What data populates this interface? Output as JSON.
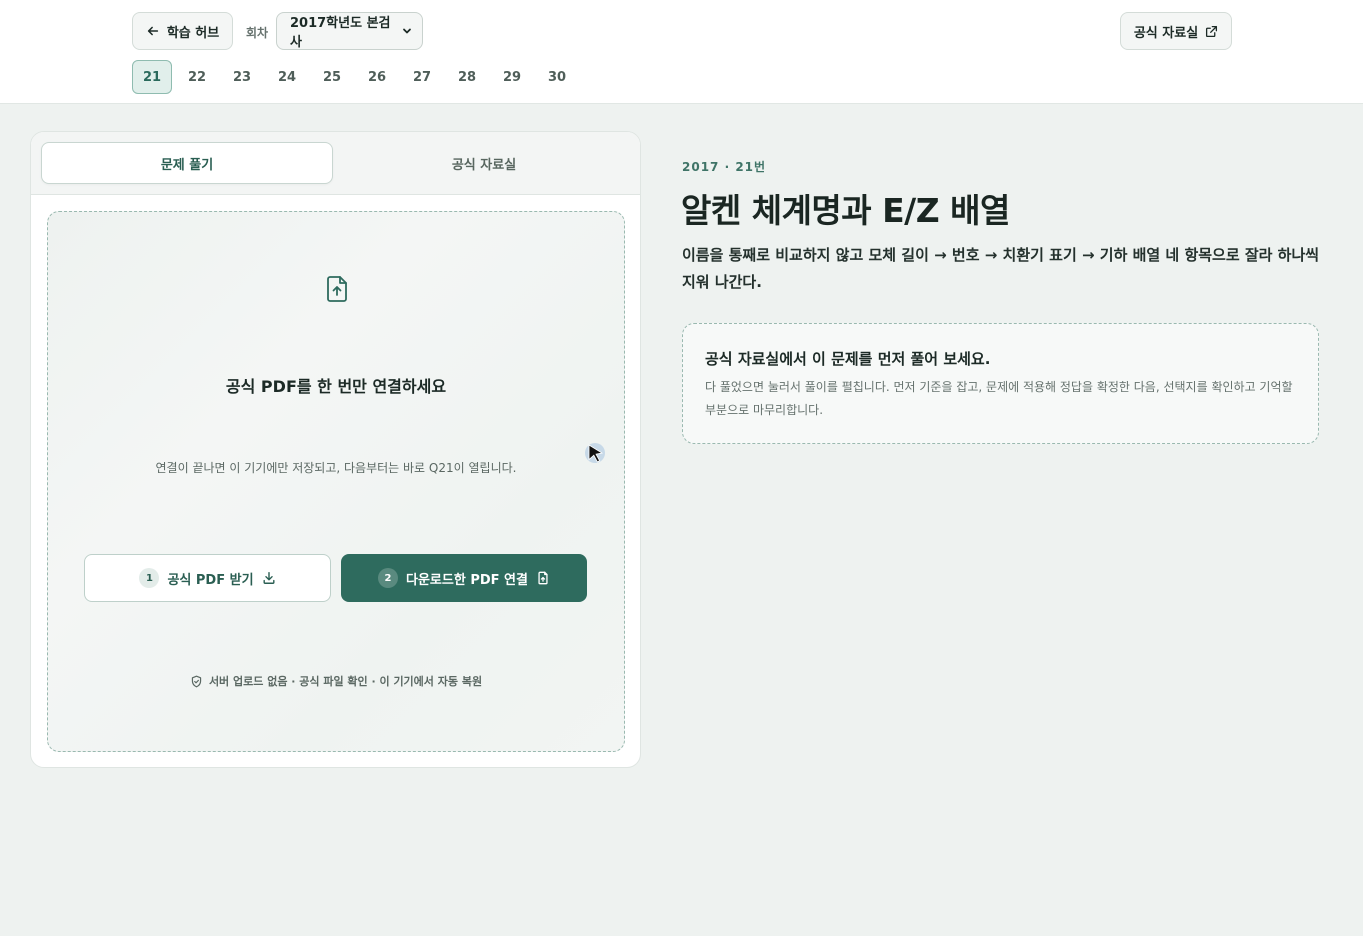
{
  "header": {
    "back_label": "학습 허브",
    "round_label": "회차",
    "round_selected": "2017학년도 본검사",
    "official_label": "공식 자료실"
  },
  "question_nav": [
    "21",
    "22",
    "23",
    "24",
    "25",
    "26",
    "27",
    "28",
    "29",
    "30"
  ],
  "active_question": "21",
  "tabs": [
    "문제 풀기",
    "공식 자료실"
  ],
  "dropzone": {
    "title": "공식 PDF를 한 번만 연결하세요",
    "description": "연결이 끝나면 이 기기에만 저장되고, 다음부터는 바로 Q21이 열립니다.",
    "get_pdf": {
      "step": "1",
      "label": "공식 PDF 받기"
    },
    "link_pdf": {
      "step": "2",
      "label": "다운로드한 PDF 연결"
    },
    "footer": "서버 업로드 없음 · 공식 파일 확인 · 이 기기에서 자동 복원"
  },
  "content": {
    "eyebrow": "2017 · 21번",
    "title": "알켄 체계명과 E/Z 배열",
    "subtitle": "이름을 통째로 비교하지 않고 모체 길이 → 번호 → 치환기 표기 → 기하 배열 네 항목으로 잘라 하나씩 지워 나간다.",
    "info_title": "공식 자료실에서 이 문제를 먼저 풀어 보세요.",
    "info_body": "다 풀었으면 눌러서 풀이를 펼칩니다. 먼저 기준을 잡고, 문제에 적용해 정답을 확정한 다음, 선택지를 확인하고 기억할 부분으로 마무리합니다."
  },
  "colors": {
    "accent": "#2e6b5e",
    "accent_light": "#e1efeb",
    "background": "#eef2f0"
  },
  "icons": [
    "arrow-left-icon",
    "chevron-down-icon",
    "external-link-icon",
    "file-upload-icon",
    "download-icon",
    "file-link-icon",
    "shield-check-icon",
    "mouse-cursor-icon"
  ]
}
